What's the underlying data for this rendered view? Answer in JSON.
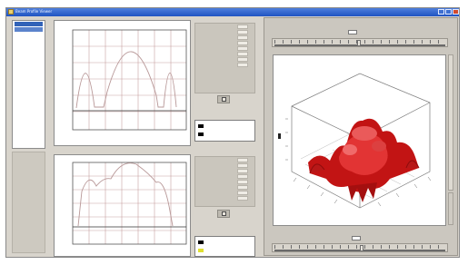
{
  "window": {
    "title": "Beam Profile Viewer",
    "controls": [
      "minimize-icon",
      "maximize-icon",
      "close-icon"
    ]
  },
  "left_list": {
    "items": [
      {
        "label": "",
        "selected": true
      },
      {
        "label": "",
        "selected": true
      }
    ]
  },
  "plots": [
    {
      "id": "plot-top",
      "ylabel": "",
      "xlabel": ""
    },
    {
      "id": "plot-bottom",
      "ylabel": "",
      "xlabel": ""
    }
  ],
  "surface": {
    "slider_top_label": "",
    "slider_top_value": "",
    "slider_bottom_label": "",
    "slider_bottom_value": ""
  },
  "colors": {
    "titlebar": "#2c5fcc",
    "panel": "#d8d4cc",
    "selection": "#3162b8",
    "surface": "#d01818"
  }
}
